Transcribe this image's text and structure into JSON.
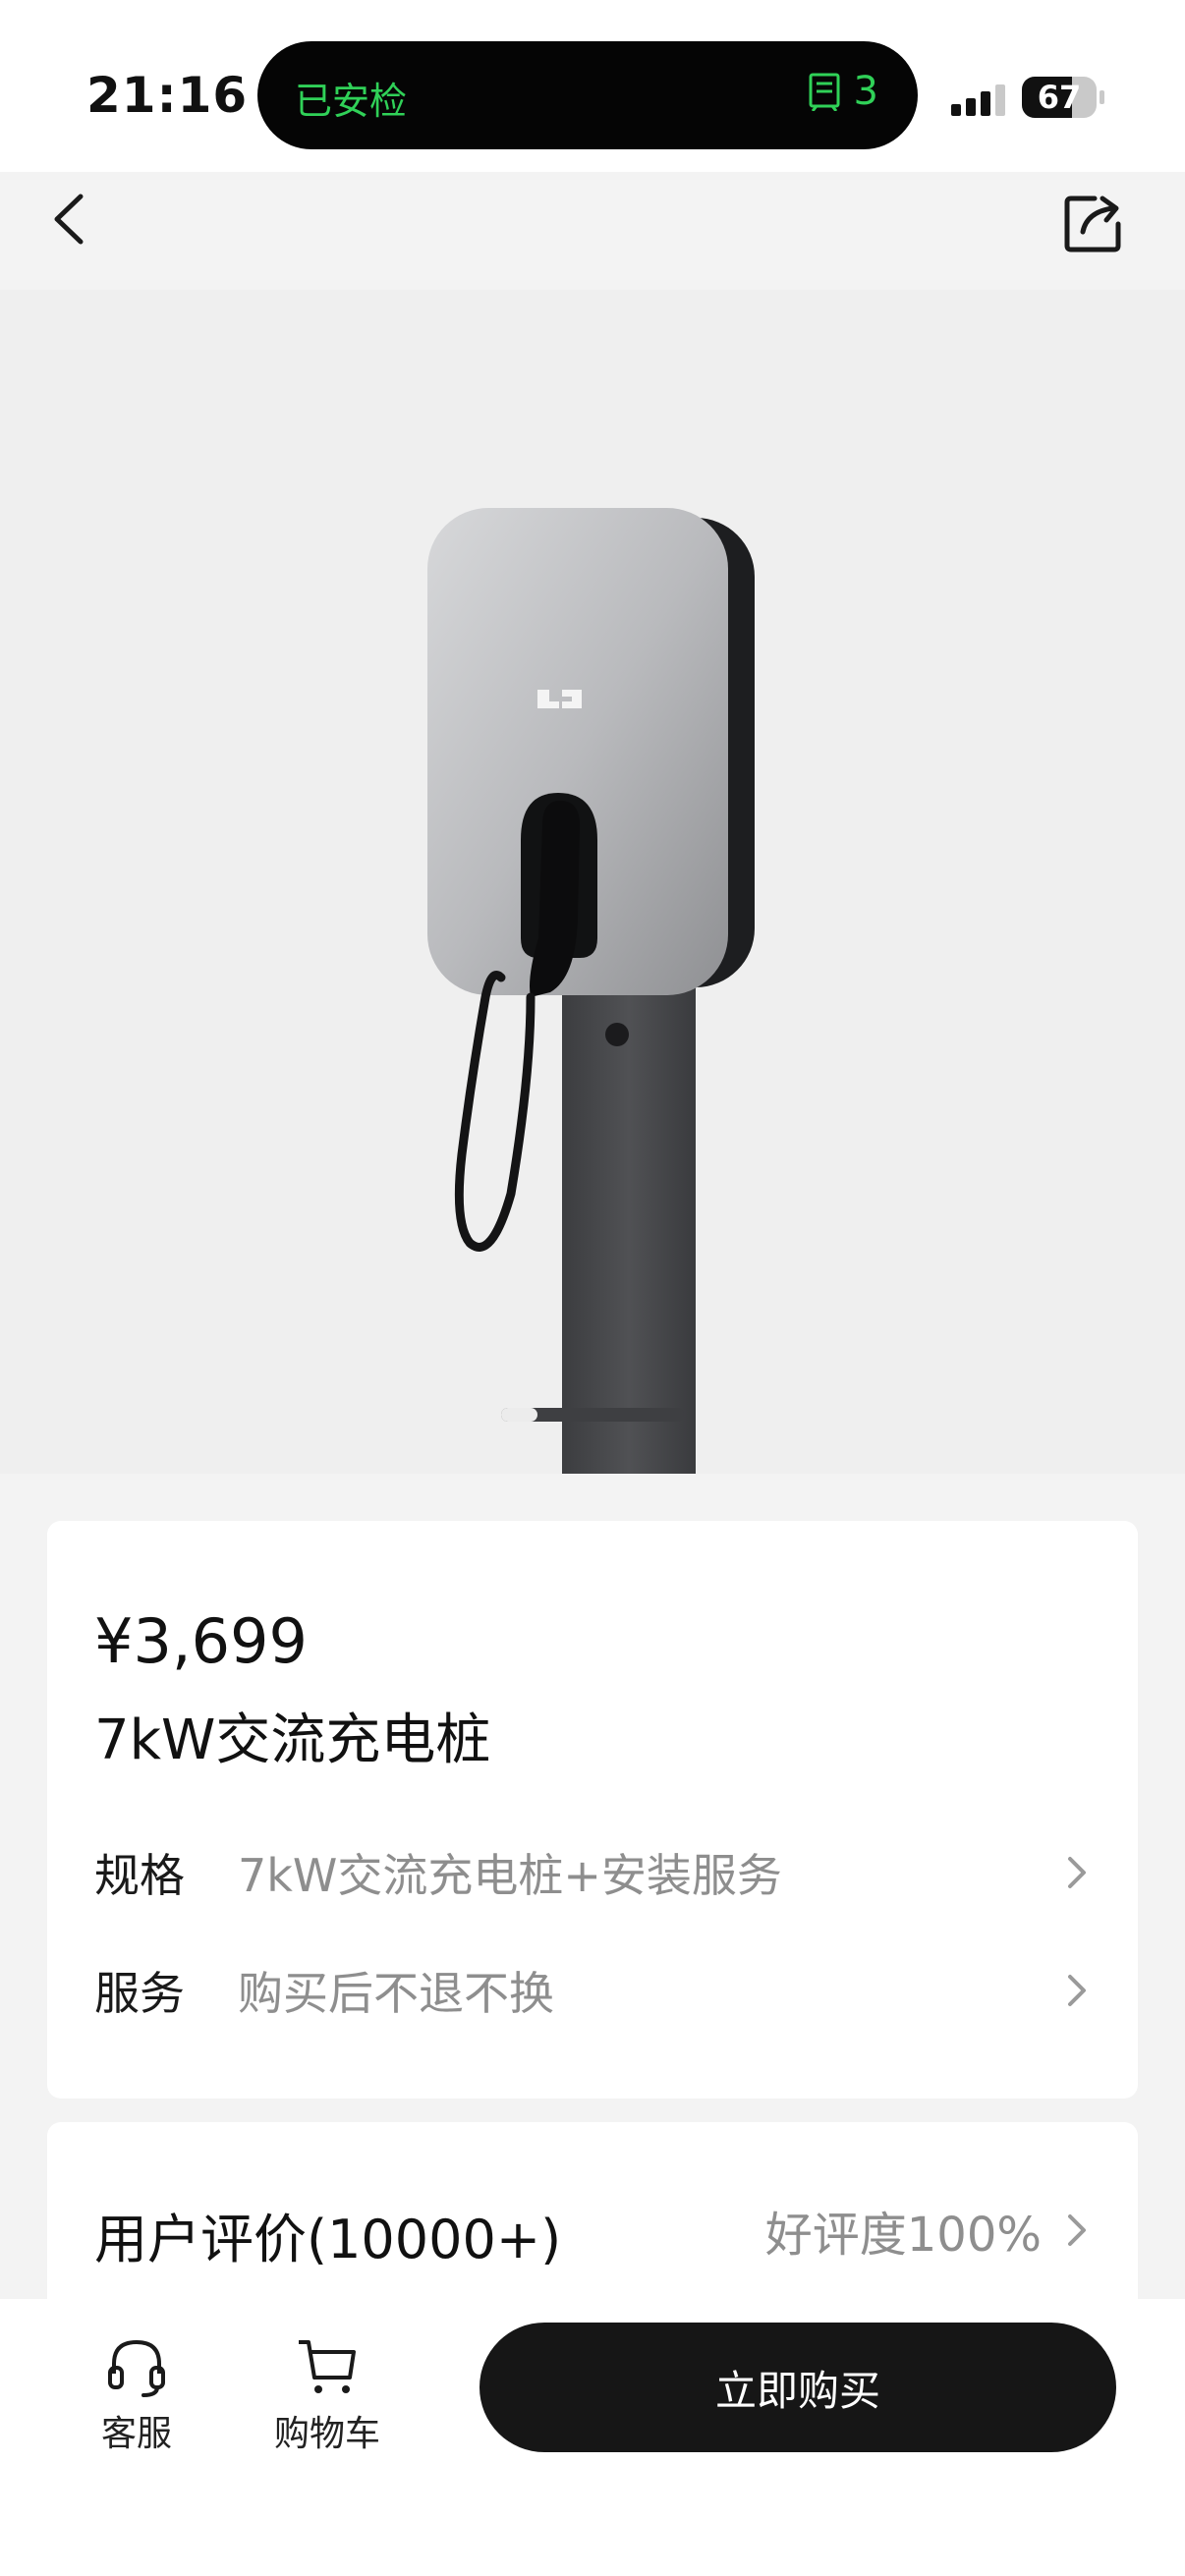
{
  "status_bar": {
    "time": "21:16",
    "island_left": "已安检",
    "island_right_count": "3",
    "battery_percent": "67",
    "battery_level": 0.67,
    "accent_color": "#30d158"
  },
  "nav": {
    "back_icon": "chevron-left-icon",
    "share_icon": "share-icon"
  },
  "hero": {
    "image_subject": "ev-charger-photo",
    "pager_progress": 0.2
  },
  "product": {
    "price": "¥3,699",
    "title": "7kW交流充电桩",
    "rows": [
      {
        "label": "规格",
        "value": "7kW交流充电桩+安装服务"
      },
      {
        "label": "服务",
        "value": "购买后不退不换"
      }
    ]
  },
  "reviews": {
    "title": "用户评价(10000+)",
    "rate": "好评度100%"
  },
  "bottom_bar": {
    "service_label": "客服",
    "cart_label": "购物车",
    "buy_label": "立即购买",
    "service_icon": "headset-icon",
    "cart_icon": "cart-icon"
  }
}
